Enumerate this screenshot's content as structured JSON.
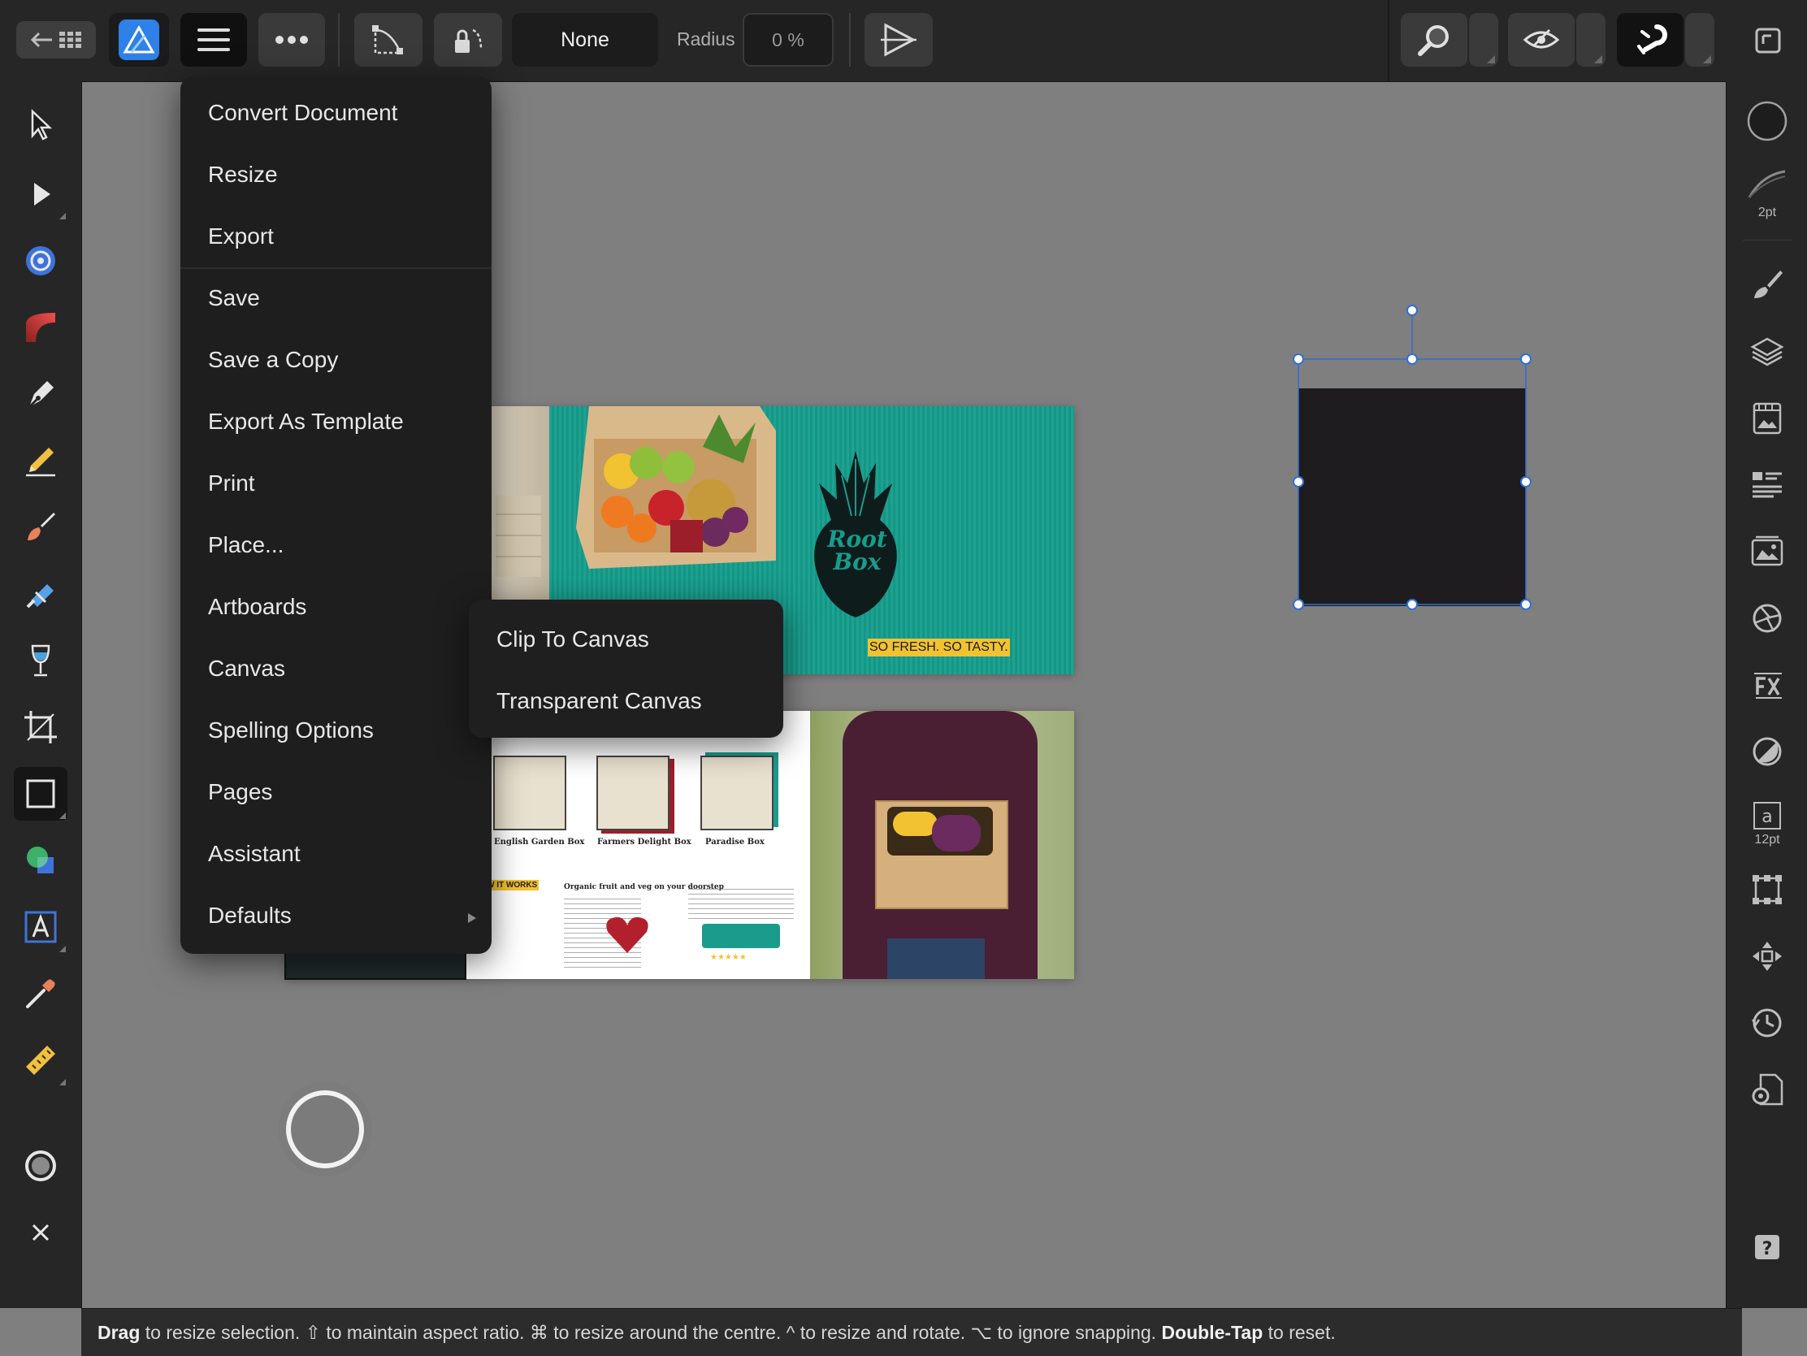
{
  "toolbar": {
    "corner_type": "None",
    "radius_label": "Radius",
    "radius_value": "0 %"
  },
  "menu": {
    "items": [
      "Convert Document",
      "Resize",
      "Export",
      "Save",
      "Save a Copy",
      "Export As Template",
      "Print",
      "Place...",
      "Artboards",
      "Canvas",
      "Spelling Options",
      "Pages",
      "Assistant",
      "Defaults"
    ],
    "submenu": [
      "Clip To Canvas",
      "Transparent Canvas"
    ]
  },
  "right_panel": {
    "stroke_width": "2pt",
    "font_size": "12pt"
  },
  "canvas": {
    "brand_logo_text": "Root Box",
    "tagline": "SO FRESH. SO TASTY.",
    "boxes": [
      "English Garden Box",
      "Farmers Delight Box",
      "Paradise Box"
    ],
    "headline": "Organic fruit and veg on your doorstep",
    "how_it_works": "HOW IT WORKS"
  },
  "status": {
    "drag": "Drag",
    "t1": " to resize selection. ⇧ to maintain aspect ratio. ⌘ to resize around the centre. ^ to resize and rotate. ⌥ to ignore snapping. ",
    "double_tap": "Double-Tap",
    "t2": " to reset."
  },
  "colors": {
    "accent_blue": "#3b7bdc",
    "teal": "#1aa08e",
    "tagline_yellow": "#f2c230",
    "selection_handle": "#2f6fd6",
    "selected_shape": "#1e1c1f"
  },
  "icons": {
    "back": "back-arrow-icon",
    "grid": "grid-icon",
    "app_logo": "affinity-designer-logo-icon",
    "hamburger": "hamburger-menu-icon",
    "more": "more-options-icon"
  }
}
